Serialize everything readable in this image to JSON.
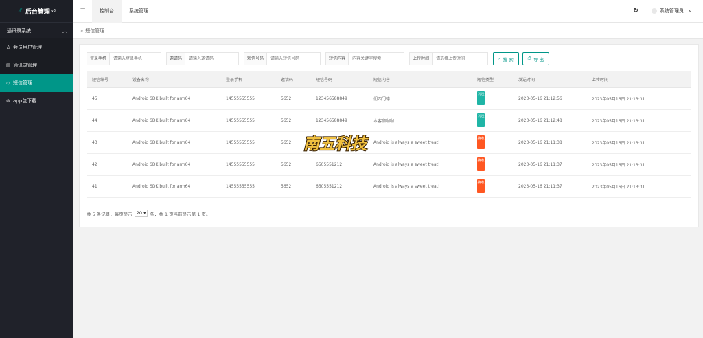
{
  "sidebar": {
    "app_title": "后台管理",
    "version": "v3",
    "group_label": "通讯录系统",
    "items": [
      {
        "label": "会员用户管理",
        "icon": "user-icon"
      },
      {
        "label": "通讯录管理",
        "icon": "contacts-icon"
      },
      {
        "label": "短信管理",
        "icon": "message-icon"
      },
      {
        "label": "app包下载",
        "icon": "download-icon"
      }
    ]
  },
  "header": {
    "tabs": [
      "控制台",
      "系统管理"
    ],
    "user_name": "系统管理员"
  },
  "breadcrumb": {
    "current": "短信管理"
  },
  "filters": [
    {
      "label": "登录手机",
      "placeholder": "请输入登录手机"
    },
    {
      "label": "邀请码",
      "placeholder": "请输入邀请码"
    },
    {
      "label": "短信号码",
      "placeholder": "请输入短信号码"
    },
    {
      "label": "短信内容",
      "placeholder": "内容关键字搜索"
    },
    {
      "label": "上传时间",
      "placeholder": "请选择上传时间"
    }
  ],
  "buttons": {
    "search": "搜 索",
    "export": "导 出"
  },
  "table": {
    "columns": [
      "短信编号",
      "设备名称",
      "登录手机",
      "邀请码",
      "短信号码",
      "短信内容",
      "短信类型",
      "发送时间",
      "上传时间"
    ],
    "rows": [
      {
        "id": "45",
        "device": "Android SDK built for arm64",
        "phone": "14555555555",
        "invite": "5652",
        "sms_number": "123456588849",
        "content": "们四门德",
        "type": "发送",
        "type_kind": "send",
        "send_time": "2023-05-16 21:12:56",
        "upload_time": "2023年05月16日 21:13:31"
      },
      {
        "id": "44",
        "device": "Android SDK built for arm64",
        "phone": "14555555555",
        "invite": "5652",
        "sms_number": "123456588849",
        "content": "本客咖咖咖",
        "type": "发送",
        "type_kind": "send",
        "send_time": "2023-05-16 21:12:48",
        "upload_time": "2023年05月16日 21:13:31"
      },
      {
        "id": "43",
        "device": "Android SDK built for arm64",
        "phone": "14555555555",
        "invite": "5652",
        "sms_number": "",
        "content": "Android is always a sweet treat!",
        "type": "接收",
        "type_kind": "recv",
        "send_time": "2023-05-16 21:11:38",
        "upload_time": "2023年05月16日 21:13:31"
      },
      {
        "id": "42",
        "device": "Android SDK built for arm64",
        "phone": "14555555555",
        "invite": "5652",
        "sms_number": "6505551212",
        "content": "Android is always a sweet treat!",
        "type": "接收",
        "type_kind": "recv",
        "send_time": "2023-05-16 21:11:37",
        "upload_time": "2023年05月16日 21:13:31"
      },
      {
        "id": "41",
        "device": "Android SDK built for arm64",
        "phone": "14555555555",
        "invite": "5652",
        "sms_number": "6505551212",
        "content": "Android is always a sweet treat!",
        "type": "接收",
        "type_kind": "recv",
        "send_time": "2023-05-16 21:11:37",
        "upload_time": "2023年05月16日 21:13:31"
      }
    ]
  },
  "pager": {
    "prefix": "共 5 条记录，每页显示",
    "page_size": "20",
    "suffix": "条，共 1 页当前显示第 1 页。"
  },
  "watermark_text": "南五科技",
  "colors": {
    "accent": "#009688",
    "send": "#1fb5a6",
    "recv": "#ff5722",
    "sidebar": "#20222a"
  }
}
